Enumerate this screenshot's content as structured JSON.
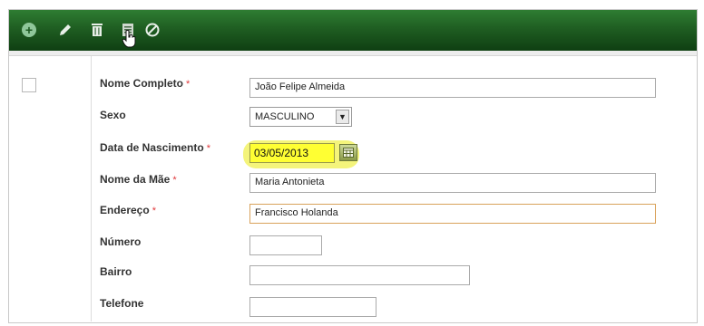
{
  "toolbar": {
    "icons": [
      "add-icon",
      "pencil-icon",
      "trash-icon",
      "print-icon",
      "cancel-icon"
    ],
    "colors": {
      "top": "#2e7d32",
      "bottom": "#0f3f12"
    }
  },
  "form": {
    "required_mark": "*",
    "nome_completo": {
      "label": "Nome Completo",
      "value": "João Felipe Almeida"
    },
    "sexo": {
      "label": "Sexo",
      "value": "MASCULINO"
    },
    "data_nascimento": {
      "label": "Data de Nascimento",
      "value": "03/05/2013"
    },
    "nome_mae": {
      "label": "Nome da Mãe",
      "value": "Maria Antonieta"
    },
    "endereco": {
      "label": "Endereço",
      "value": "Francisco Holanda"
    },
    "numero": {
      "label": "Número",
      "value": ""
    },
    "bairro": {
      "label": "Bairro",
      "value": ""
    },
    "telefone": {
      "label": "Telefone",
      "value": ""
    }
  },
  "highlight_color": "#f4f47b"
}
